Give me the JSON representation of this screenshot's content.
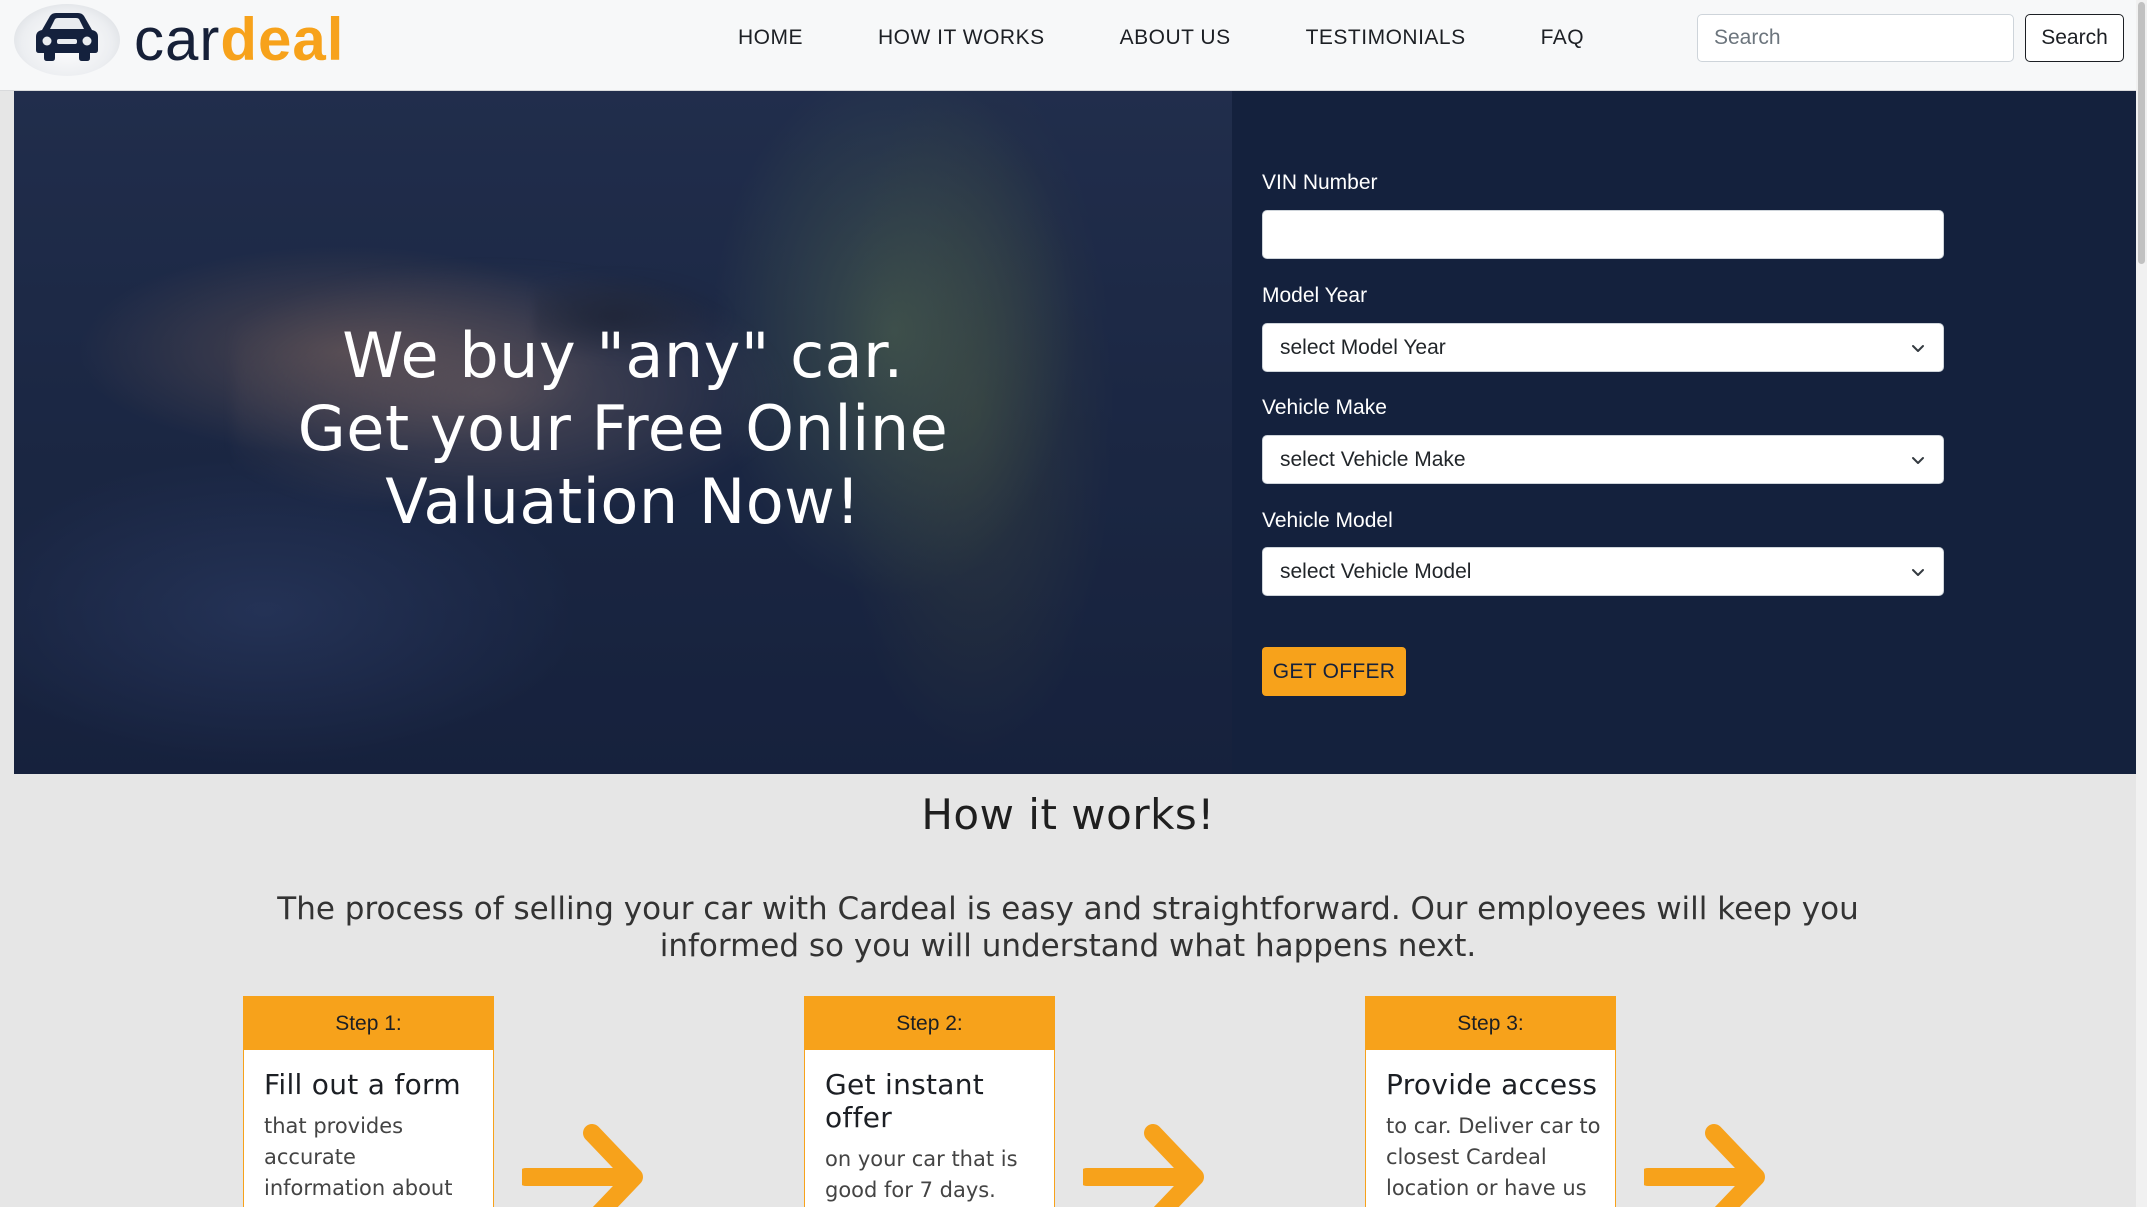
{
  "brand": {
    "name_part1": "car",
    "name_part2": "deal",
    "logo_icon": "car-icon",
    "accent_color": "#f7a21b",
    "navy_color": "#14213d"
  },
  "nav": {
    "links": [
      "HOME",
      "HOW IT WORKS",
      "ABOUT US",
      "TESTIMONIALS",
      "FAQ"
    ],
    "search_placeholder": "Search",
    "search_button": "Search"
  },
  "hero": {
    "heading_lines": [
      "We buy \"any\" car.",
      "Get your Free Online",
      "Valuation Now!"
    ]
  },
  "form": {
    "vin_label": "VIN Number",
    "vin_value": "",
    "year_label": "Model Year",
    "year_selected": "select Model Year",
    "make_label": "Vehicle Make",
    "make_selected": "select Vehicle Make",
    "model_label": "Vehicle Model",
    "model_selected": "select Vehicle Model",
    "submit_label": "GET OFFER"
  },
  "how": {
    "title": "How it works!",
    "description": "The process of selling your car with Cardeal is easy and straightforward. Our employees will keep you informed so you will understand what happens next.",
    "steps": [
      {
        "label": "Step 1:",
        "title": "Fill out a form",
        "body": "that provides accurate information about your car. (i.e,"
      },
      {
        "label": "Step 2:",
        "title": "Get instant offer",
        "body": "on your car that is good for 7 days."
      },
      {
        "label": "Step 3:",
        "title": "Provide access",
        "body": "to car. Deliver car to closest Cardeal location or have us"
      }
    ]
  }
}
